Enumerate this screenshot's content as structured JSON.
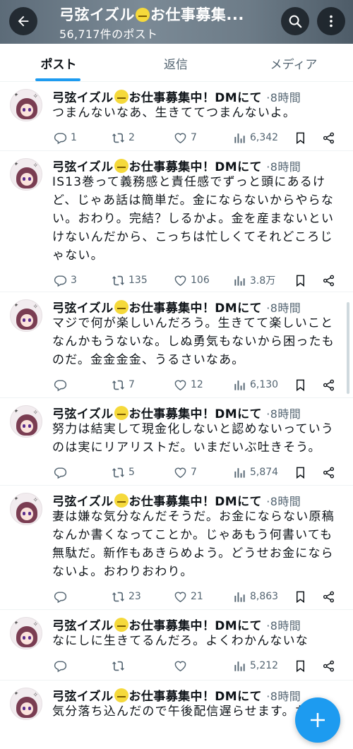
{
  "header": {
    "title_pre": "弓弦イズル",
    "title_emoji": "melting-face-emoji",
    "title_post": "お仕事募集...",
    "post_count": "56,717件のポスト"
  },
  "tabs": [
    {
      "label": "ポスト",
      "active": true
    },
    {
      "label": "返信",
      "active": false
    },
    {
      "label": "メディア",
      "active": false
    }
  ],
  "accent_color": "#1d9bf0",
  "posts": [
    {
      "name_pre": "弓弦イズル",
      "name_post": "お仕事募集中！DMにて",
      "time": "·8時間",
      "text": "つまんないなあ、生きててつまんないよ。",
      "reply": "1",
      "retweet": "2",
      "like": "7",
      "views": "6,342"
    },
    {
      "name_pre": "弓弦イズル",
      "name_post": "お仕事募集中！DMにて",
      "time": "·8時間",
      "text": "IS13巻って義務感と責任感でずっと頭にあるけど、じゃあ話は簡単だ。金にならないからやらない。おわり。完結？しるかよ。金を産まないといけないんだから、こっちは忙しくてそれどころじゃない。",
      "reply": "3",
      "retweet": "135",
      "like": "106",
      "views": "3.8万"
    },
    {
      "name_pre": "弓弦イズル",
      "name_post": "お仕事募集中！DMにて",
      "time": "·8時間",
      "text": "マジで何が楽しいんだろう。生きてて楽しいことなんかもうないな。しぬ勇気もないから困ったものだ。金金金金、うるさいなあ。",
      "reply": "",
      "retweet": "7",
      "like": "12",
      "views": "6,130"
    },
    {
      "name_pre": "弓弦イズル",
      "name_post": "お仕事募集中！DMにて",
      "time": "·8時間",
      "text": "努力は結実して現金化しないと認めないっていうのは実にリアリストだ。いまだいぶ吐きそう。",
      "reply": "",
      "retweet": "5",
      "like": "7",
      "views": "5,874"
    },
    {
      "name_pre": "弓弦イズル",
      "name_post": "お仕事募集中！DMにて",
      "time": "·8時間",
      "text": "妻は嫌な気分なんだそうだ。お金にならない原稿なんか書くなってことか。じゃあもう何書いても無駄だ。新作もあきらめよう。どうせお金にならないよ。おわりおわり。",
      "reply": "",
      "retweet": "23",
      "like": "21",
      "views": "8,863"
    },
    {
      "name_pre": "弓弦イズル",
      "name_post": "お仕事募集中！DMにて",
      "time": "·8時間",
      "text": "なにしに生きてるんだろ。よくわかんないな",
      "reply": "",
      "retweet": "",
      "like": "",
      "views": "5,212"
    },
    {
      "name_pre": "弓弦イズル",
      "name_post": "お仕事募集中！DMにて",
      "time": "·8時間",
      "text": "気分落ち込んだので午後配信遅らせます。ない",
      "reply": "",
      "retweet": "",
      "like": "",
      "views": ""
    }
  ],
  "icons": {
    "back": "arrow-left-icon",
    "search": "search-icon",
    "more": "more-vertical-icon",
    "reply": "reply-icon",
    "retweet": "retweet-icon",
    "like": "heart-icon",
    "views": "views-icon",
    "bookmark": "bookmark-icon",
    "share": "share-icon",
    "compose": "plus-icon"
  }
}
